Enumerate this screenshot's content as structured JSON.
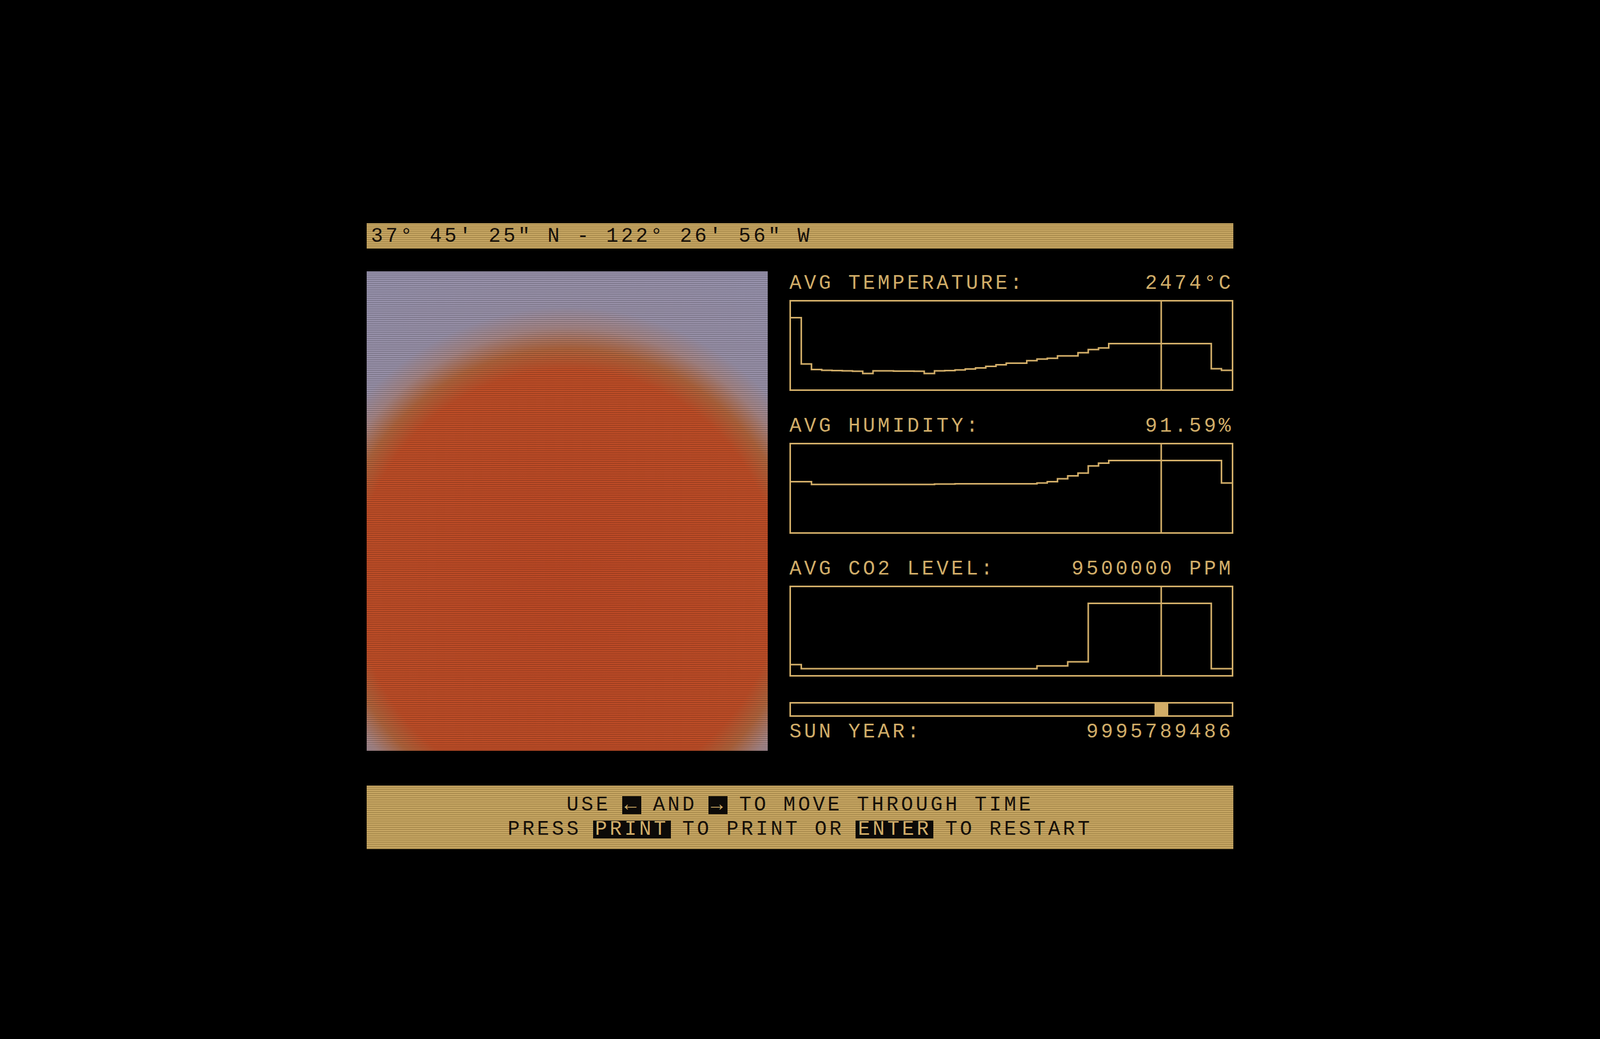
{
  "location": "37° 45' 25\" N - 122° 26' 56\" W",
  "metrics": [
    {
      "label": "AVG TEMPERATURE:",
      "value": "2474°C",
      "series": [
        4100,
        1200,
        850,
        800,
        780,
        760,
        740,
        600,
        760,
        760,
        750,
        750,
        740,
        600,
        760,
        780,
        820,
        880,
        950,
        1050,
        1150,
        1250,
        1250,
        1400,
        1500,
        1550,
        1700,
        1700,
        1900,
        2100,
        2200,
        2474,
        2474,
        2474,
        2474,
        2474,
        2474,
        2474,
        2474,
        2474,
        2474,
        900,
        800
      ]
    },
    {
      "label": "AVG HUMIDITY:",
      "value": "91.59%",
      "series": [
        62,
        62,
        58,
        58,
        58,
        58,
        58,
        58,
        58,
        58,
        58,
        58,
        58,
        58,
        58.5,
        58.5,
        59,
        59,
        59,
        59,
        59,
        59,
        59,
        59,
        60,
        62,
        66,
        70,
        74,
        84,
        88,
        91.59,
        91.59,
        91.59,
        91.59,
        91.59,
        91.59,
        91.59,
        91.59,
        91.59,
        91.59,
        91.59,
        60
      ]
    },
    {
      "label": "AVG CO2 LEVEL:",
      "value": "9500000 PPM",
      "series": [
        600000,
        420,
        420,
        420,
        420,
        420,
        420,
        420,
        420,
        420,
        420,
        420,
        420,
        420,
        420,
        420,
        420,
        420,
        420,
        420,
        420,
        420,
        420,
        420,
        400000,
        400000,
        400000,
        1000000,
        1000000,
        9500000,
        9500000,
        9500000,
        9500000,
        9500000,
        9500000,
        9500000,
        9500000,
        9500000,
        9500000,
        9500000,
        9500000,
        420,
        420
      ]
    }
  ],
  "timeline": {
    "level": 0.84
  },
  "sun_year": {
    "label": "SUN YEAR:",
    "value": "9995789486"
  },
  "instructions": [
    [
      {
        "kind": "text",
        "text": "USE"
      },
      {
        "kind": "key",
        "text": "←"
      },
      {
        "kind": "text",
        "text": "AND"
      },
      {
        "kind": "key",
        "text": "→"
      },
      {
        "kind": "text",
        "text": "TO MOVE THROUGH TIME"
      }
    ],
    [
      {
        "kind": "text",
        "text": "PRESS"
      },
      {
        "kind": "key",
        "text": "PRINT"
      },
      {
        "kind": "text",
        "text": "TO PRINT OR"
      },
      {
        "kind": "key",
        "text": "ENTER"
      },
      {
        "kind": "text",
        "text": "TO RESTART"
      }
    ]
  ]
}
